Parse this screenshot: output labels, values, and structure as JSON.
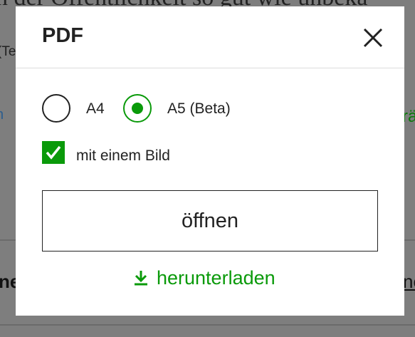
{
  "background": {
    "headline_fragment": "n der Öffentlichkeit so gut wie unbeka",
    "small_fragment": "(Te",
    "left_link_fragment": "n",
    "right_link_fragment": "rä",
    "bottom_left_fragment": "ne",
    "bottom_right_fragment": "ne"
  },
  "modal": {
    "title": "PDF",
    "close_icon": "close-icon",
    "format_options": [
      {
        "label": "A4",
        "selected": false
      },
      {
        "label": "A5 (Beta)",
        "selected": true
      }
    ],
    "with_image": {
      "label": "mit einem Bild",
      "checked": true
    },
    "open_button": "öffnen",
    "download_link": "herunterladen",
    "download_icon": "download-icon"
  },
  "colors": {
    "accent": "#0a9a0a",
    "overlay": "#808080",
    "text": "#222222"
  }
}
